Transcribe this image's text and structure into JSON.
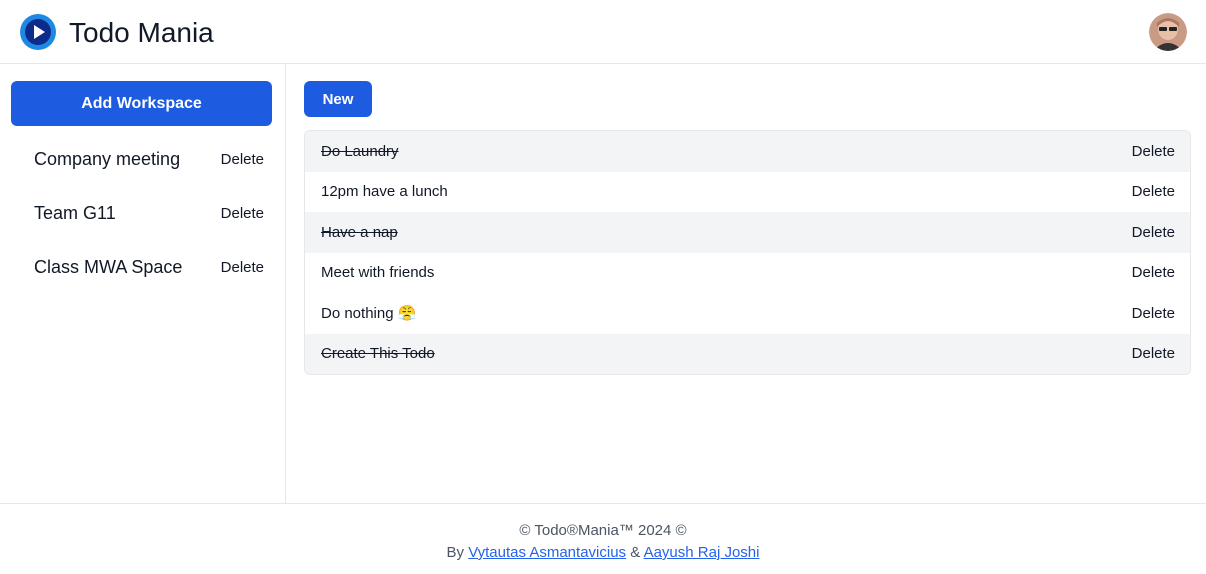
{
  "header": {
    "app_title": "Todo Mania",
    "logo_icon": "play-logo-icon",
    "avatar_icon": "user-avatar"
  },
  "sidebar": {
    "add_workspace_label": "Add Workspace",
    "workspaces": [
      {
        "name": "Company meeting",
        "delete_label": "Delete"
      },
      {
        "name": "Team G11",
        "delete_label": "Delete"
      },
      {
        "name": "Class MWA Space",
        "delete_label": "Delete"
      }
    ]
  },
  "main": {
    "new_label": "New",
    "todos": [
      {
        "text": "Do Laundry",
        "done": true,
        "delete_label": "Delete"
      },
      {
        "text": "12pm have a lunch",
        "done": false,
        "delete_label": "Delete"
      },
      {
        "text": "Have a nap",
        "done": true,
        "delete_label": "Delete"
      },
      {
        "text": "Meet with friends",
        "done": false,
        "delete_label": "Delete"
      },
      {
        "text": "Do nothing 😤",
        "done": false,
        "delete_label": "Delete"
      },
      {
        "text": "Create This Todo",
        "done": true,
        "delete_label": "Delete"
      }
    ]
  },
  "footer": {
    "copyright": "© Todo®Mania™ 2024 ©",
    "by_prefix": "By",
    "author1": "Vytautas Asmantavicius",
    "separator": "&",
    "author2": "Aayush Raj Joshi"
  },
  "colors": {
    "primary": "#1d5be0",
    "link": "#2563eb",
    "row_alt": "#f3f4f6"
  }
}
